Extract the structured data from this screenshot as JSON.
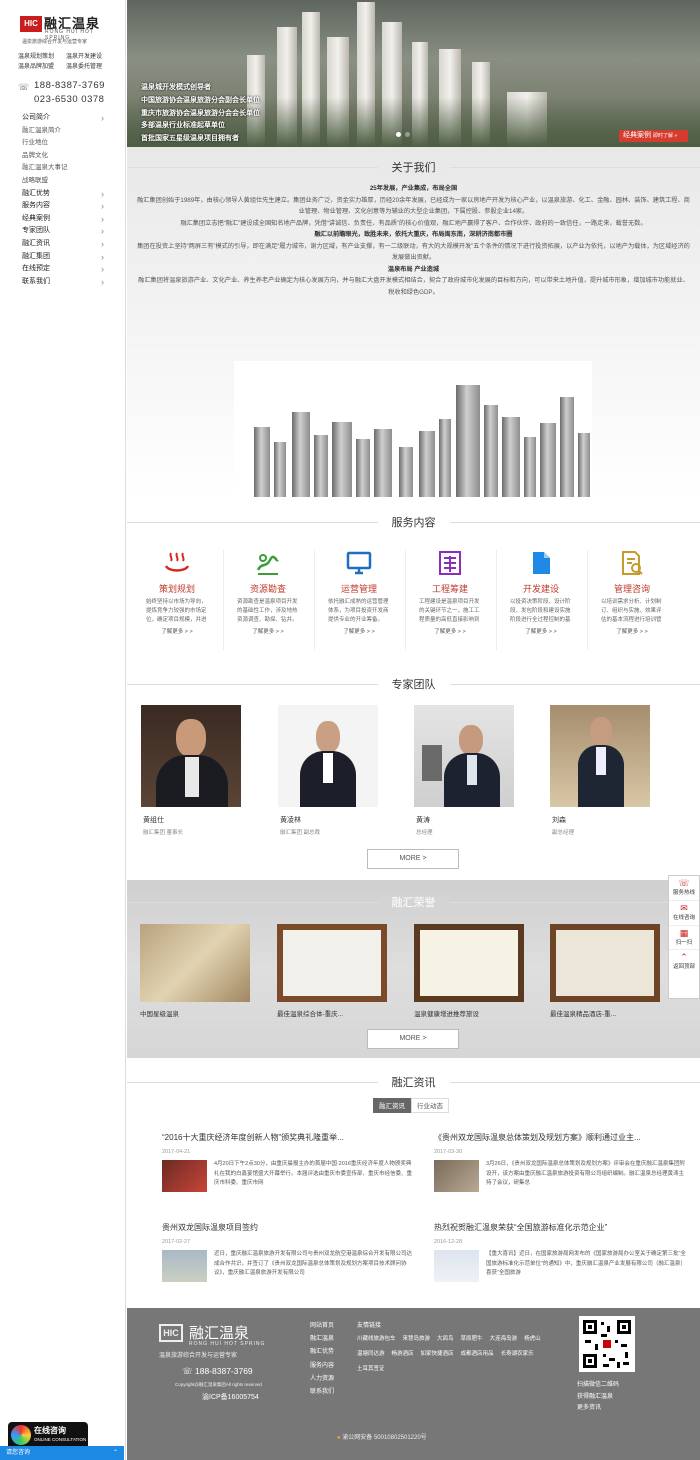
{
  "brand": {
    "mark": "HIC",
    "name": "融汇温泉",
    "en": "RONG HUI HOT SPRING",
    "slogan": "温泉旅游综合开发与运营专家"
  },
  "service_links": [
    "温泉规划策划",
    "温泉开发建设",
    "温泉品牌加盟",
    "温泉委托管理"
  ],
  "phones": [
    "188-8387-3769",
    "023-6530 0378"
  ],
  "nav": [
    {
      "label": "公司简介",
      "chev": true,
      "sub": false
    },
    {
      "label": "融汇温泉简介",
      "chev": false,
      "sub": true
    },
    {
      "label": "行业地位",
      "chev": false,
      "sub": true
    },
    {
      "label": "品牌文化",
      "chev": false,
      "sub": true
    },
    {
      "label": "融汇温泉大事记",
      "chev": false,
      "sub": true
    },
    {
      "label": "战略联盟",
      "chev": false,
      "sub": true
    },
    {
      "label": "融汇优势",
      "chev": true,
      "sub": false
    },
    {
      "label": "服务内容",
      "chev": true,
      "sub": false
    },
    {
      "label": "经典案例",
      "chev": true,
      "sub": false
    },
    {
      "label": "专家团队",
      "chev": true,
      "sub": false
    },
    {
      "label": "融汇资讯",
      "chev": true,
      "sub": false
    },
    {
      "label": "融汇集团",
      "chev": true,
      "sub": false
    },
    {
      "label": "在线预定",
      "chev": true,
      "sub": false
    },
    {
      "label": "联系我们",
      "chev": true,
      "sub": false
    }
  ],
  "hero": {
    "lines": [
      "温泉城开发模式创导者",
      "中国旅游协会温泉旅游分会副会长单位",
      "重庆市旅游协会温泉旅游分会会长单位",
      "多部温泉行业标准起草单位",
      "首批国家五星级温泉项目拥有者"
    ],
    "case_button": "经典案例",
    "case_button_small": "即时了解 »"
  },
  "about": {
    "title": "关于我们",
    "paragraphs": [
      {
        "bold": true,
        "text": "25年发展，产业集成，布局全国"
      },
      {
        "bold": false,
        "text": "融汇集团创始于1989年，由核心领导人黄组仕先生建立。集团业务广泛，资金实力雄厚，历经20余年发展，已经成为一家以房地产开发为核心产业，以温泉旅游、化工、金融、园林、装饰、建筑工程、商业管理、物业管理、文化创意等为辅业的大型企业集团，下属控股、参股企业14家。"
      },
      {
        "bold": false,
        "text": "融汇集团立志把“融汇”建设成全国知名地产品牌，凭借“讲诚信、负责任、有品质”的核心价值观，融汇地产赢得了客户、合作伙伴、政府的一致信任，一路走来，载誉无数。"
      },
      {
        "bold": true,
        "text": "融汇以前瞻眼光，致胜未来，依托大重庆，布局闽东南，深耕济南都市圈"
      },
      {
        "bold": false,
        "text": "集团在投资上坚持“两屏三有”模式的引导，即在满足“履力城市，谢力区域，有产业支撑，有一二级联动，有大的大规模开发”五个条件的情况下进行投资拓展，以产业为依托，以地产为载体，为区域经济的发展做出贡献。"
      },
      {
        "bold": true,
        "text": "温泉布局 产业造城"
      },
      {
        "bold": false,
        "text": "融汇集团将温泉旅游产业、文化产业、养生养老产业确定为核心发展方向，并与融汇大盘开发模式相结合，契合了政府城市化发展的目标和方向，可以带来土地升值，提升城市形象，增加城市功能就业、税收和绿色GDP。"
      }
    ]
  },
  "services": {
    "title": "服务内容",
    "items": [
      {
        "icon": "hot-spring-icon",
        "title": "策划规划",
        "desc": "始终坚持以市场为导向，提炼竞争力较强的市场定位，确定项目规模，并进行规划。",
        "more": "了解更多 > >",
        "color": "#d7261e"
      },
      {
        "icon": "resource-survey-icon",
        "title": "资源勘查",
        "desc": "资源勘查是温泉项目开发的基础性工作，涉及地热资源调查、勘探、钻井。",
        "more": "了解更多 > >",
        "color": "#3a9d3a"
      },
      {
        "icon": "monitor-icon",
        "title": "运营管理",
        "desc": "依托融汇成熟的运营管理体系，为项目投资开发商提供专业的开业筹备。",
        "more": "了解更多 > >",
        "color": "#1f6fc0"
      },
      {
        "icon": "engineering-icon",
        "title": "工程筹建",
        "desc": "工程建设是温泉项目开发的关键环节之一，施工工程质量的高低直接影响到",
        "more": "了解更多 > >",
        "color": "#8b2fb8"
      },
      {
        "icon": "document-icon",
        "title": "开发建设",
        "desc": "以投资决策阶段、设计阶段、发包阶段和建设实施阶段进行全过程控制的基本",
        "more": "了解更多 > >",
        "color": "#1e88e5"
      },
      {
        "icon": "consult-icon",
        "title": "管理咨询",
        "desc": "以培训需求分析、计划制订、组织与实施、效果评估的基本流程进行培训管理",
        "more": "了解更多 > >",
        "color": "#c79a2c"
      }
    ]
  },
  "experts": {
    "title": "专家团队",
    "people": [
      {
        "name": "黄组仕",
        "role": "融汇集团 董事长"
      },
      {
        "name": "黄凌林",
        "role": "融汇集团 副总裁"
      },
      {
        "name": "黄涛",
        "role": "总经理"
      },
      {
        "name": "刘森",
        "role": "副总经理"
      }
    ],
    "more": "MORE >"
  },
  "honors": {
    "title": "融汇荣誉",
    "items": [
      {
        "caption": "中国星级温泉"
      },
      {
        "caption": "最佳温泉综合体-重庆..."
      },
      {
        "caption": "温泉健康增进推荐旅设"
      },
      {
        "caption": "最佳温泉精品酒店-重..."
      }
    ],
    "more": "MORE >"
  },
  "news": {
    "title": "融汇资讯",
    "tabs": [
      "融汇资讯",
      "行业动态"
    ],
    "items": [
      {
        "title": "“2016十大重庆经济年度创新人物”颁奖典礼隆重举...",
        "date": "2017-04-21",
        "text": "4月20日下午2点30分，由重庆晨报主办的首届中国·2016重庆经济年度人物颁奖典礼在我的白鑫宴馆盛大开幕举行。本届评选由重庆市委宣传部、重庆市经信委、重庆市科委、重庆市网"
      },
      {
        "title": "《贵州双龙国际温泉总体策划及规划方案》顺利通过业主...",
        "date": "2017-03-30",
        "text": "3月26日，《贵州双龙国际温泉总体策划及规划方案》评审会在重庆融汇温泉集团附设开，该方案由重庆融汇温泉旅游投资有限公司组织编制。融汇温泉总经理黄涛主持了会议，研集总"
      },
      {
        "title": "贵州双龙国际温泉项目签约",
        "date": "2017-02-27",
        "text": "近日，重庆融汇温泉旅游开发有限公司与贵州双龙航空港温泉综合开发有限公司达成合作共识，并签订了《贵州双龙国际温泉总体策划及规划方案项目技术顾问协议》，重庆融汇温泉旅游开发有限公司"
      },
      {
        "title": "热烈祝贺融汇温泉荣获“全国旅游标准化示范企业”",
        "date": "2016-12-28",
        "text": "【重大喜讯】近日，在国家旅游局网发布的《国家旅游局办公室关于确定第三批“全国旅游标准化示范单位”的通知》中，重庆融汇温泉产业发展有限公司（融汇温泉）喜获“全国旅游"
      }
    ]
  },
  "footer": {
    "mark": "HIC",
    "name": "融汇温泉",
    "en": "RONG HUI HOT SPRING",
    "slogan": "温泉旅游综合开发与运营专家",
    "phone": "188-8387-3769",
    "copyright": "Copyright@融汇温泉集团All rights reserved",
    "icp": "渝ICP备16005754",
    "col1": [
      "网站首页",
      "融汇温泉",
      "融汇优势",
      "服务内容",
      "人力资源",
      "联系我们"
    ],
    "links_head": "友情链接",
    "links": [
      "川藏线旅游包车",
      "来慧岛旅游",
      "大鸽鸟",
      "草原肥牛",
      "大连海岛游",
      "杨虎山",
      "温塘同达游",
      "畅游酒店",
      "如家快捷酒店",
      "成都酒店用品",
      "长寿湖农家乐",
      "土耳其签证"
    ],
    "qr_lines": [
      "扫描微信二维码",
      "获得融汇温泉",
      "更多资讯"
    ],
    "gongan": "渝公网安备 50010802501220号"
  },
  "float_bar": [
    {
      "icon": "phone-icon",
      "label": "服务热线"
    },
    {
      "icon": "chat-icon",
      "label": "在线咨询"
    },
    {
      "icon": "qr-icon",
      "label": "扫一扫"
    },
    {
      "icon": "top-icon",
      "label": "返回顶部"
    }
  ],
  "chat": {
    "title": "在线咨询",
    "sub": "ONLINE CONSULTATION",
    "bar": "请您咨询"
  }
}
